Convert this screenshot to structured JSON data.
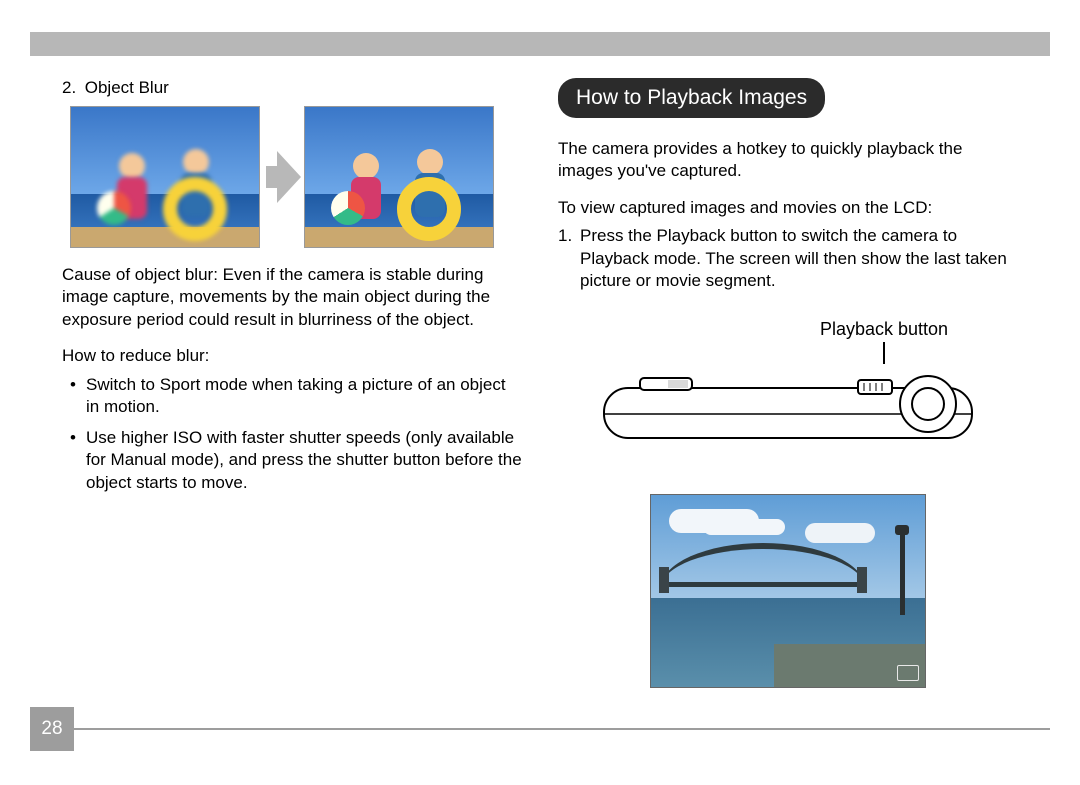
{
  "page_number": "28",
  "left": {
    "item_number": "2.",
    "item_title": "Object Blur",
    "cause_text": "Cause of object blur: Even if the camera is stable during image capture, movements by the main object during the exposure period could result in blurriness of the object.",
    "reduce_heading": "How to reduce blur:",
    "bullets": [
      "Switch to Sport mode when taking a picture of an object in motion.",
      "Use higher ISO with faster shutter speeds (only available for Manual mode), and press the shutter button before the object starts to move."
    ]
  },
  "right": {
    "section_title": "How to Playback Images",
    "intro": "The camera provides a hotkey to quickly playback the images you've captured.",
    "instructions_lead": "To view captured images and movies on the LCD:",
    "step_number": "1.",
    "step_text": "Press the Playback button to switch the camera to Playback mode. The screen will then show the last taken picture or movie segment.",
    "callout_label": "Playback button"
  }
}
